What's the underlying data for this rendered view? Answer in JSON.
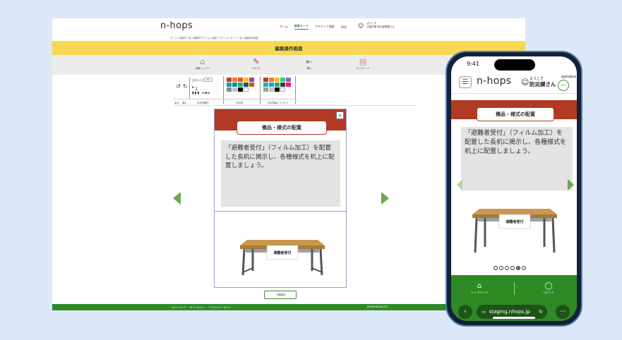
{
  "desktop": {
    "logo": {
      "text": "n-hops"
    },
    "nav": [
      "ホーム",
      "編集モード",
      "アカウント検索",
      "FAQ"
    ],
    "user": {
      "line1": "ようこそ",
      "line2": "災害対策 防災管理課さん"
    },
    "breadcrumb": "ホーム＞避難所一覧＞避難所アクション画面＞アクションカード一覧＞編集操作画面",
    "page_title": "編集操作画面",
    "toolbar": [
      {
        "label": "画像トップへ",
        "icon": "home-icon"
      },
      {
        "label": "テキスト",
        "icon": "pencil-icon"
      },
      {
        "label": "挿入",
        "icon": "insert-icon"
      },
      {
        "label": "テンプレート",
        "icon": "document-icon"
      }
    ],
    "panel": {
      "font_size_label": "文字サイズ",
      "font_size_value": "42",
      "bold_label": "B",
      "underline_label": "U",
      "undo_label": "戻る",
      "redo_label": "進む",
      "text_format_label": "文字列操作",
      "text_color_label": "文字色",
      "text_highlight_label": "文字背景ハイライト"
    },
    "modal": {
      "title": "備品・様式の配置",
      "body": "「避難者受付」（フィルム加工）を配置した長机に掲示し、各種様式を机上に配置しましょう。",
      "sign": "避難者受付",
      "close": "×"
    },
    "save_button": "一時保存",
    "footer": {
      "links": "→サイトマップ　→サイトポリシー　→プライバシーポリシー",
      "copyright": "NOHMI BOSAI LTD."
    }
  },
  "phone": {
    "time": "9:41",
    "logo": "n-hops",
    "greeting": "ようこそ",
    "user_name": "防災課さん",
    "badge_top": "避難所開設率",
    "badge_value": "0/0",
    "title": "備品・様式の配置",
    "body": "「避難者受付」（フィルム加工）を配置した長机に掲示し、各種様式を机上に配置しましょう。",
    "sign": "避難者受付",
    "dots": {
      "total": 6,
      "active": 5
    },
    "nav": [
      {
        "label": "トップページ",
        "icon": "home-icon"
      },
      {
        "label": "コメント",
        "icon": "comment-icon"
      }
    ],
    "url": "staging.nhops.jp"
  },
  "colors": {
    "accent_green": "#2f8a26",
    "header_red": "#b03a24",
    "title_yellow": "#f7d754",
    "arrow_green": "#6aa84f"
  }
}
